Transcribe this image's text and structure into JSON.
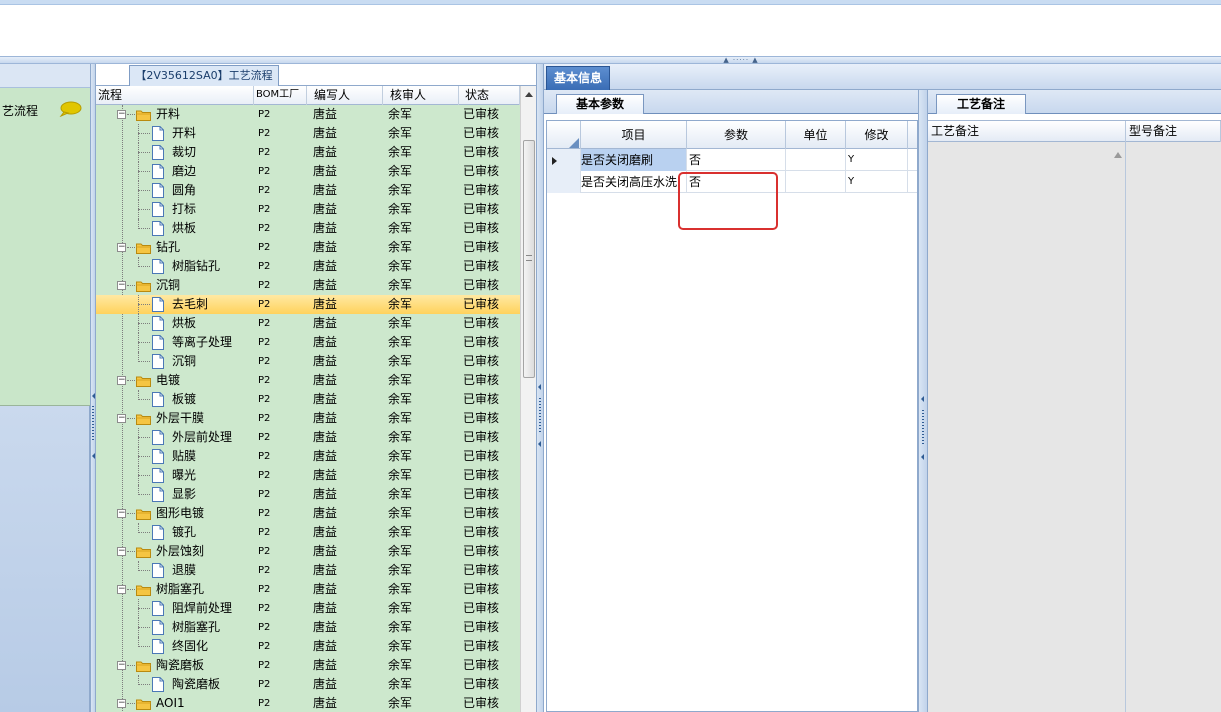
{
  "left_panel": {
    "item_label": "艺流程",
    "icon": "speech-bubble-icon"
  },
  "tree": {
    "tab_title": "【2V35612SA0】工艺流程",
    "columns": {
      "flow": "流程",
      "bom": "BOM工厂",
      "writer": "编写人",
      "checker": "核审人",
      "status": "状态"
    },
    "rows": [
      {
        "name": "开料",
        "level": 0,
        "type": "folder",
        "bom": "P2",
        "writer": "唐益",
        "checker": "余军",
        "status": "已审核"
      },
      {
        "name": "开料",
        "level": 1,
        "type": "file",
        "bom": "P2",
        "writer": "唐益",
        "checker": "余军",
        "status": "已审核"
      },
      {
        "name": "裁切",
        "level": 1,
        "type": "file",
        "bom": "P2",
        "writer": "唐益",
        "checker": "余军",
        "status": "已审核"
      },
      {
        "name": "磨边",
        "level": 1,
        "type": "file",
        "bom": "P2",
        "writer": "唐益",
        "checker": "余军",
        "status": "已审核"
      },
      {
        "name": "圆角",
        "level": 1,
        "type": "file",
        "bom": "P2",
        "writer": "唐益",
        "checker": "余军",
        "status": "已审核"
      },
      {
        "name": "打标",
        "level": 1,
        "type": "file",
        "bom": "P2",
        "writer": "唐益",
        "checker": "余军",
        "status": "已审核"
      },
      {
        "name": "烘板",
        "level": 1,
        "type": "file",
        "bom": "P2",
        "writer": "唐益",
        "checker": "余军",
        "status": "已审核"
      },
      {
        "name": "钻孔",
        "level": 0,
        "type": "folder",
        "bom": "P2",
        "writer": "唐益",
        "checker": "余军",
        "status": "已审核"
      },
      {
        "name": "树脂钻孔",
        "level": 1,
        "type": "file",
        "bom": "P2",
        "writer": "唐益",
        "checker": "余军",
        "status": "已审核"
      },
      {
        "name": "沉铜",
        "level": 0,
        "type": "folder",
        "bom": "P2",
        "writer": "唐益",
        "checker": "余军",
        "status": "已审核"
      },
      {
        "name": "去毛刺",
        "level": 1,
        "type": "file",
        "bom": "P2",
        "writer": "唐益",
        "checker": "余军",
        "status": "已审核",
        "selected": true
      },
      {
        "name": "烘板",
        "level": 1,
        "type": "file",
        "bom": "P2",
        "writer": "唐益",
        "checker": "余军",
        "status": "已审核"
      },
      {
        "name": "等离子处理",
        "level": 1,
        "type": "file",
        "bom": "P2",
        "writer": "唐益",
        "checker": "余军",
        "status": "已审核"
      },
      {
        "name": "沉铜",
        "level": 1,
        "type": "file",
        "bom": "P2",
        "writer": "唐益",
        "checker": "余军",
        "status": "已审核"
      },
      {
        "name": "电镀",
        "level": 0,
        "type": "folder",
        "bom": "P2",
        "writer": "唐益",
        "checker": "余军",
        "status": "已审核"
      },
      {
        "name": "板镀",
        "level": 1,
        "type": "file",
        "bom": "P2",
        "writer": "唐益",
        "checker": "余军",
        "status": "已审核"
      },
      {
        "name": "外层干膜",
        "level": 0,
        "type": "folder",
        "bom": "P2",
        "writer": "唐益",
        "checker": "余军",
        "status": "已审核"
      },
      {
        "name": "外层前处理",
        "level": 1,
        "type": "file",
        "bom": "P2",
        "writer": "唐益",
        "checker": "余军",
        "status": "已审核"
      },
      {
        "name": "贴膜",
        "level": 1,
        "type": "file",
        "bom": "P2",
        "writer": "唐益",
        "checker": "余军",
        "status": "已审核"
      },
      {
        "name": "曝光",
        "level": 1,
        "type": "file",
        "bom": "P2",
        "writer": "唐益",
        "checker": "余军",
        "status": "已审核"
      },
      {
        "name": "显影",
        "level": 1,
        "type": "file",
        "bom": "P2",
        "writer": "唐益",
        "checker": "余军",
        "status": "已审核"
      },
      {
        "name": "图形电镀",
        "level": 0,
        "type": "folder",
        "bom": "P2",
        "writer": "唐益",
        "checker": "余军",
        "status": "已审核"
      },
      {
        "name": "镀孔",
        "level": 1,
        "type": "file",
        "bom": "P2",
        "writer": "唐益",
        "checker": "余军",
        "status": "已审核"
      },
      {
        "name": "外层蚀刻",
        "level": 0,
        "type": "folder",
        "bom": "P2",
        "writer": "唐益",
        "checker": "余军",
        "status": "已审核"
      },
      {
        "name": "退膜",
        "level": 1,
        "type": "file",
        "bom": "P2",
        "writer": "唐益",
        "checker": "余军",
        "status": "已审核"
      },
      {
        "name": "树脂塞孔",
        "level": 0,
        "type": "folder",
        "bom": "P2",
        "writer": "唐益",
        "checker": "余军",
        "status": "已审核"
      },
      {
        "name": "阻焊前处理",
        "level": 1,
        "type": "file",
        "bom": "P2",
        "writer": "唐益",
        "checker": "余军",
        "status": "已审核"
      },
      {
        "name": "树脂塞孔",
        "level": 1,
        "type": "file",
        "bom": "P2",
        "writer": "唐益",
        "checker": "余军",
        "status": "已审核"
      },
      {
        "name": "终固化",
        "level": 1,
        "type": "file",
        "bom": "P2",
        "writer": "唐益",
        "checker": "余军",
        "status": "已审核"
      },
      {
        "name": "陶瓷磨板",
        "level": 0,
        "type": "folder",
        "bom": "P2",
        "writer": "唐益",
        "checker": "余军",
        "status": "已审核"
      },
      {
        "name": "陶瓷磨板",
        "level": 1,
        "type": "file",
        "bom": "P2",
        "writer": "唐益",
        "checker": "余军",
        "status": "已审核"
      },
      {
        "name": "AOI1",
        "level": 0,
        "type": "folder",
        "bom": "P2",
        "writer": "唐益",
        "checker": "余军",
        "status": "已审核"
      }
    ]
  },
  "basic_info": {
    "tab_label": "基本信息",
    "params_tab_label": "基本参数",
    "columns": {
      "item": "项目",
      "param": "参数",
      "unit": "单位",
      "modify": "修改"
    },
    "rows": [
      {
        "item": "是否关闭磨刷",
        "param": "否",
        "unit": "",
        "modify": "Y"
      },
      {
        "item": "是否关闭高压水洗",
        "param": "否",
        "unit": "",
        "modify": "Y"
      }
    ]
  },
  "remarks": {
    "tab_label": "工艺备注",
    "columns": {
      "remark": "工艺备注",
      "model_remark": "型号备注"
    }
  },
  "colors": {
    "tree_bg": "#cde8cd",
    "selected_row": "#ffd25c",
    "accent_tab": "#3a6db5",
    "highlight_box": "#d9302f"
  }
}
